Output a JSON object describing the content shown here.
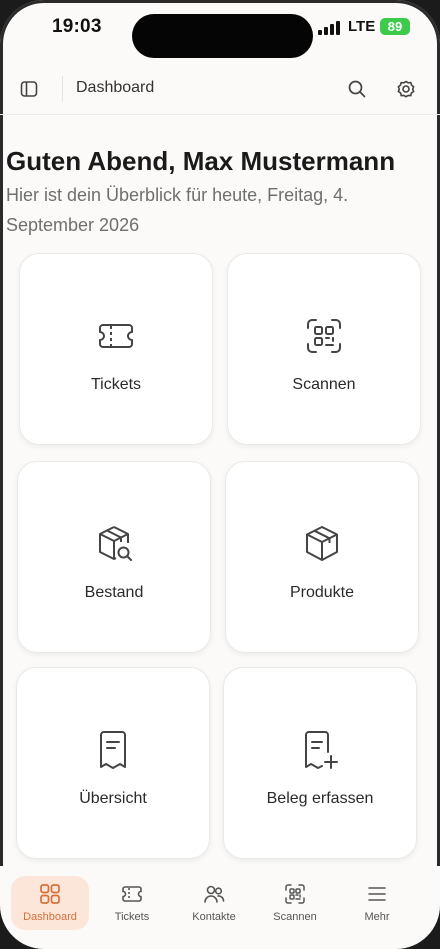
{
  "status_bar": {
    "time": "19:03",
    "network": "LTE",
    "battery": "89"
  },
  "topbar": {
    "sidebar_icon": "sidebar-toggle-icon",
    "breadcrumb": "Dashboard",
    "search_icon": "search-icon",
    "settings_icon": "settings-icon"
  },
  "header": {
    "greeting": "Guten Abend, Max Mustermann",
    "subtitle": "Hier ist dein Überblick für heute, Freitag, 4. September 2026"
  },
  "tiles": [
    {
      "label": "Tickets",
      "icon": "ticket-icon"
    },
    {
      "label": "Scannen",
      "icon": "scan-icon"
    },
    {
      "label": "Bestand",
      "icon": "inventory-search-icon"
    },
    {
      "label": "Produkte",
      "icon": "package-icon"
    },
    {
      "label": "Übersicht",
      "icon": "receipt-icon"
    },
    {
      "label": "Beleg erfassen",
      "icon": "receipt-add-icon"
    }
  ],
  "tabbar": {
    "active": "Dashboard",
    "items": [
      {
        "label": "Dashboard",
        "icon": "dashboard-grid-icon"
      },
      {
        "label": "Tickets",
        "icon": "ticket-icon"
      },
      {
        "label": "Kontakte",
        "icon": "contacts-icon"
      },
      {
        "label": "Scannen",
        "icon": "scan-icon"
      },
      {
        "label": "Mehr",
        "icon": "menu-icon"
      }
    ]
  },
  "colors": {
    "accent": "#d76f3a",
    "accent_bg": "#fbe6d9",
    "background": "#fbfaf8",
    "battery": "#3ecb4c"
  }
}
